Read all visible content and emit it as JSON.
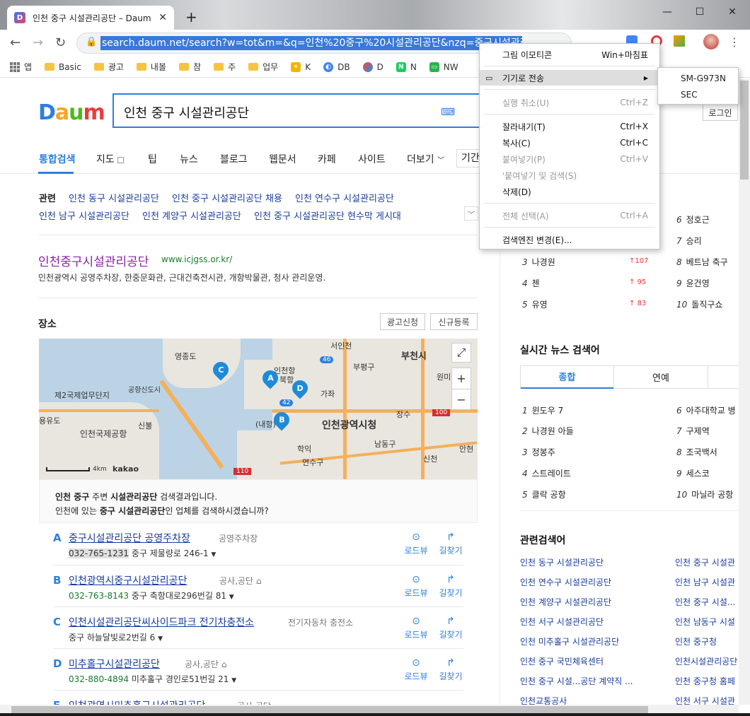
{
  "window": {
    "tab_title": "인천 중구 시설관리공단 – Daum",
    "tab_favicon": "D",
    "new_tab": "+",
    "minimize": "—",
    "maximize": "☐",
    "close": "✕"
  },
  "toolbar": {
    "back": "←",
    "forward": "→",
    "reload": "↻",
    "url": "search.daum.net/search?w=tot&m=&q=인천%20중구%20시설관리공단&nzq=중구시설관리공"
  },
  "bookmarks": [
    {
      "label": "앱",
      "icon": "apps-grid-icon"
    },
    {
      "label": "Basic",
      "icon": "folder-icon"
    },
    {
      "label": "광고",
      "icon": "folder-icon"
    },
    {
      "label": "내볼",
      "icon": "folder-icon"
    },
    {
      "label": "참",
      "icon": "folder-icon"
    },
    {
      "label": "주",
      "icon": "folder-icon"
    },
    {
      "label": "업무",
      "icon": "folder-icon"
    },
    {
      "label": "K",
      "icon": "bulb-icon"
    },
    {
      "label": "DB",
      "icon": "db-icon"
    },
    {
      "label": "D",
      "icon": "drive-icon"
    },
    {
      "label": "N",
      "icon": "naver-icon"
    },
    {
      "label": "NW",
      "icon": "monitor-icon"
    }
  ],
  "daum": {
    "logo": "Daum",
    "query": "인천 중구 시설관리공단",
    "login": "로그인",
    "gnb": [
      "통합검색",
      "지도",
      "팁",
      "뉴스",
      "블로그",
      "웹문서",
      "카페",
      "사이트",
      "더보기",
      "기간"
    ]
  },
  "related": {
    "label": "관련",
    "row1": [
      "인천 동구 시설관리공단",
      "인천 중구 시설관리공단 채용",
      "인천 연수구 시설관리공단"
    ],
    "row2": [
      "인천 남구 시설관리공단",
      "인천 계양구 시설관리공단",
      "인천 중구 시설관리공단 현수막 게시대"
    ]
  },
  "site": {
    "title": "인천중구시설관리공단",
    "url": "www.icjgss.or.kr/",
    "desc": "인천광역시 공영주차장, 한중문화관, 근대건축전시관, 개항박물관, 청사 관리운영."
  },
  "places": {
    "heading": "장소",
    "ad_button": "광고신청",
    "register_button": "신규등록",
    "map": {
      "labels": [
        "영종도",
        "서인천",
        "부천시",
        "제2국제업무단지",
        "부평구",
        "공항신도시",
        "인천항",
        "북항",
        "가좌",
        "원미",
        "용유도",
        "인천국제공항",
        "신불",
        "인천광역시청",
        "장수",
        "남동구",
        "연수구",
        "학익",
        "신천",
        "안현",
        "(내항)"
      ],
      "pins": [
        "A",
        "B",
        "C",
        "D"
      ],
      "scale": "4km",
      "brand": "kakao",
      "road_numbers": [
        "46",
        "42",
        "100",
        "110"
      ]
    },
    "notice_line1_a": "인천 중구",
    "notice_line1_b": " 주변 ",
    "notice_line1_c": "시설관리공단",
    "notice_line1_d": " 검색결과입니다.",
    "notice_line2_a": "인천에 있는 ",
    "notice_line2_b": "중구 시설관리공단",
    "notice_line2_c": "인 업체를 검색하시겠습니까?",
    "list": [
      {
        "letter": "A",
        "name": "중구시설관리공단 공영주차장",
        "category": "공영주차장",
        "tel": "032-765-1231",
        "addr": "중구 제물량로 246-1"
      },
      {
        "letter": "B",
        "name": "인천광역시중구시설관리공단",
        "category": "공사,공단",
        "tel": "032-763-8143",
        "addr": "중구 축항대로296번길 81"
      },
      {
        "letter": "C",
        "name": "인천시설관리공단씨사이드파크 전기차충전소",
        "category": "전기자동차 충전소",
        "tel": "",
        "addr": "중구 하늘달빛로2번길 6"
      },
      {
        "letter": "D",
        "name": "미추홀구시설관리공단",
        "category": "공사,공단",
        "tel": "032-880-4894",
        "addr": "미추홀구 경인로51번길 21"
      },
      {
        "letter": "E",
        "name": "인천광역시미추홀구시설관리공단",
        "category": "공사,공단",
        "tel": "",
        "addr": ""
      }
    ],
    "roadview": "로드뷰",
    "directions": "길찾기"
  },
  "ranking_top": [
    {
      "rank": "3",
      "name": "나경원",
      "delta": "107"
    },
    {
      "rank": "4",
      "name": "첸",
      "delta": "95"
    },
    {
      "rank": "5",
      "name": "유영",
      "delta": "83"
    }
  ],
  "ranking_top_right": [
    {
      "rank": "6",
      "name": "정호근"
    },
    {
      "rank": "7",
      "name": "승리"
    },
    {
      "rank": "8",
      "name": "베트남 축구"
    },
    {
      "rank": "9",
      "name": "윤건영"
    },
    {
      "rank": "10",
      "name": "돌직구쇼"
    }
  ],
  "news": {
    "heading": "실시간 뉴스 검색어",
    "tabs": [
      "종합",
      "연예"
    ],
    "left": [
      {
        "rank": "1",
        "name": "윈도우 7"
      },
      {
        "rank": "2",
        "name": "나경원 아들"
      },
      {
        "rank": "3",
        "name": "정봉주"
      },
      {
        "rank": "4",
        "name": "스트레이트"
      },
      {
        "rank": "5",
        "name": "클락 공항"
      }
    ],
    "right": [
      {
        "rank": "6",
        "name": "아주대학교 병"
      },
      {
        "rank": "7",
        "name": "구제역"
      },
      {
        "rank": "8",
        "name": "조국백서"
      },
      {
        "rank": "9",
        "name": "세스코"
      },
      {
        "rank": "10",
        "name": "마닐라 공항"
      }
    ]
  },
  "related_terms": {
    "heading": "관련검색어",
    "left": [
      "인천 동구 시설관리공단",
      "인천 연수구 시설관리공단",
      "인천 계양구 시설관리공단",
      "인천 서구 시설관리공단",
      "인천 미추홀구 시설관리공단",
      "인천 중구 국민체육센터",
      "인천 중구 시설...공단 계약직 ...",
      "인천교통공사"
    ],
    "right": [
      "인천 중구 시설관",
      "인천 남구 시설관",
      "인천 중구 시설...",
      "인천 남동구 시설",
      "인천 중구청",
      "인천시설관리공단",
      "인천 중구청 홈페",
      "인천 서구 시설관"
    ]
  },
  "context_menu": {
    "items": [
      {
        "label": "그림 이모티콘",
        "shortcut": "Win+마침표",
        "disabled": false
      },
      {
        "label": "기기로 전송",
        "shortcut": "▶",
        "disabled": false,
        "highlight": true
      },
      {
        "label": "실행 취소(U)",
        "shortcut": "Ctrl+Z",
        "disabled": true
      },
      {
        "label": "잘라내기(T)",
        "shortcut": "Ctrl+X",
        "disabled": false
      },
      {
        "label": "복사(C)",
        "shortcut": "Ctrl+C",
        "disabled": false
      },
      {
        "label": "붙여넣기(P)",
        "shortcut": "Ctrl+V",
        "disabled": true
      },
      {
        "label": "'붙여넣기 및 검색(S)",
        "shortcut": "",
        "disabled": true
      },
      {
        "label": "삭제(D)",
        "shortcut": "",
        "disabled": false
      },
      {
        "label": "전체 선택(A)",
        "shortcut": "Ctrl+A",
        "disabled": true
      },
      {
        "label": "검색엔진 변경(E)...",
        "shortcut": "",
        "disabled": false
      }
    ],
    "submenu": [
      "SM-G973N",
      "SEC"
    ]
  }
}
